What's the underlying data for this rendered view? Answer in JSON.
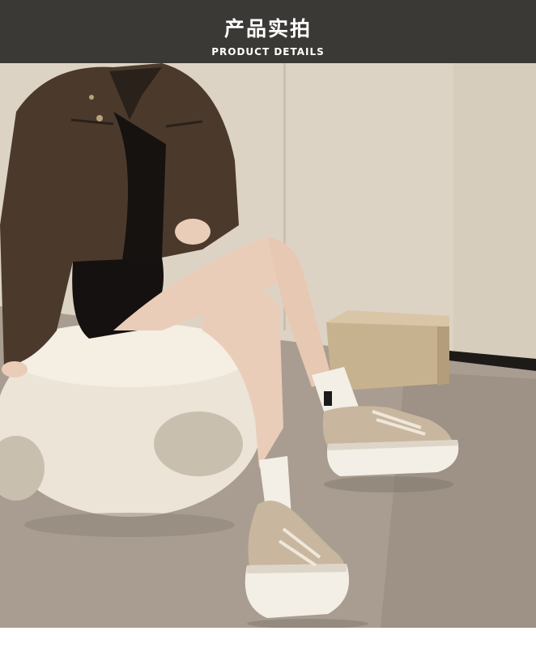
{
  "header": {
    "title_cn": "产品实拍",
    "title_en": "PRODUCT DETAILS"
  },
  "photo": {
    "subject": "product-photo",
    "colors": {
      "wall": "#ddd3c4",
      "floor": "#a89d90",
      "jacket": "#4b3a2c",
      "skin": "#eacdb9",
      "stool": "#ece4d6",
      "shoe_upper": "#c8b79e",
      "sole": "#f3efe6",
      "box": "#c7b290"
    }
  }
}
